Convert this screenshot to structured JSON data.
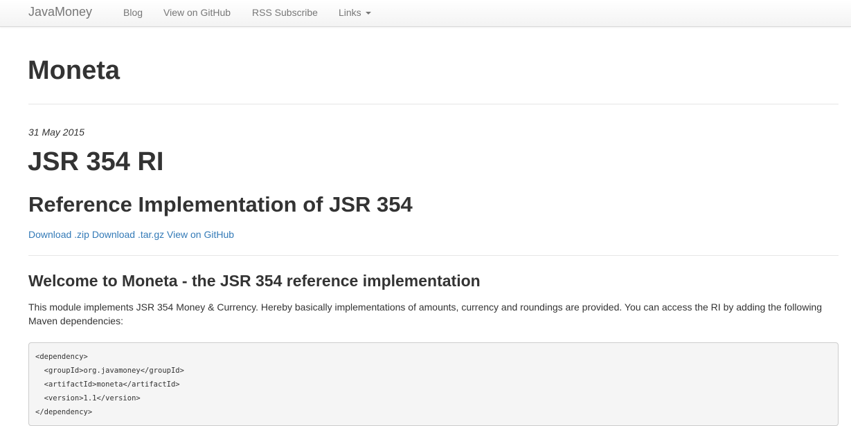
{
  "nav": {
    "brand": "JavaMoney",
    "items": [
      {
        "label": "Blog"
      },
      {
        "label": "View on GitHub"
      },
      {
        "label": "RSS Subscribe"
      },
      {
        "label": "Links"
      }
    ]
  },
  "page": {
    "title": "Moneta"
  },
  "post": {
    "date": "31 May 2015",
    "heading": "JSR 354 RI",
    "subheading": "Reference Implementation of JSR 354",
    "links": {
      "zip": "Download .zip",
      "targz": "Download .tar.gz",
      "github": "View on GitHub"
    },
    "section_title": "Welcome to Moneta - the JSR 354 reference implementation",
    "paragraph": "This module implements JSR 354 Money & Currency. Hereby basically implementations of amounts, currency and roundings are provided. You can access the RI by adding the following Maven dependencies:",
    "code_lines": [
      "<dependency>",
      "  <groupId>org.javamoney</groupId>",
      "  <artifactId>moneta</artifactId>",
      "  <version>1.1</version>",
      "</dependency>"
    ]
  },
  "colors": {
    "link": "#337ab7",
    "nav_text": "#777777",
    "text": "#333333"
  }
}
